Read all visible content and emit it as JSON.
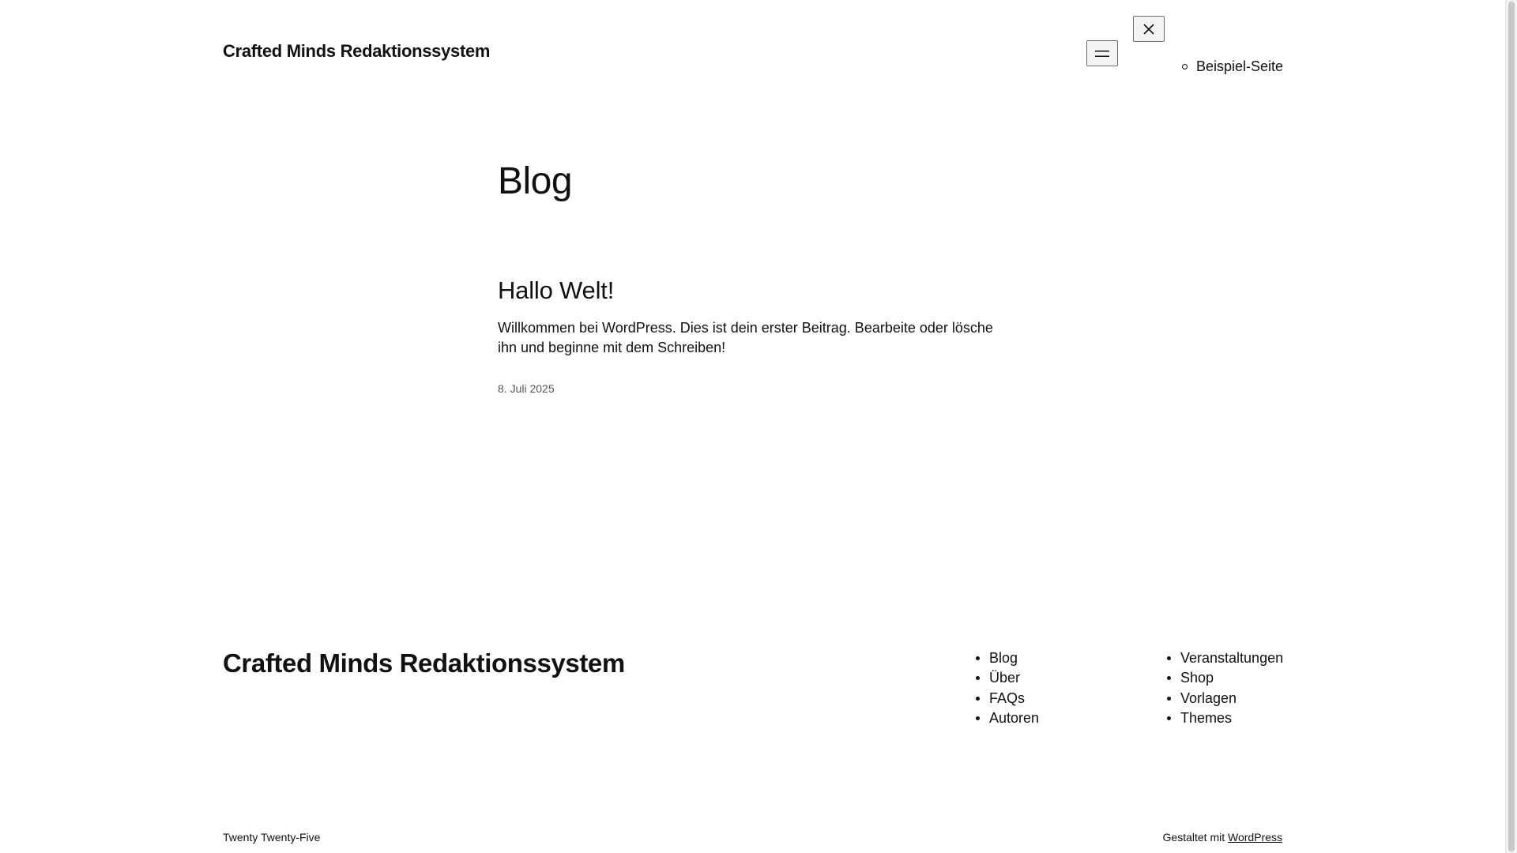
{
  "header": {
    "site_title": "Crafted Minds Redaktionssystem",
    "menu_open_icon": "menu-icon",
    "menu_close_icon": "close-icon",
    "overlay_nav": [
      {
        "label": "Beispiel-Seite"
      }
    ]
  },
  "main": {
    "page_title": "Blog",
    "posts": [
      {
        "title": "Hallo Welt!",
        "excerpt": "Willkommen bei WordPress. Dies ist dein erster Beitrag. Bearbeite oder lösche ihn und beginne mit dem Schreiben!",
        "date": "8. Juli 2025"
      }
    ]
  },
  "footer": {
    "site_title": "Crafted Minds Redaktionssystem",
    "nav_col1": [
      {
        "label": "Blog"
      },
      {
        "label": "Über"
      },
      {
        "label": "FAQs"
      },
      {
        "label": "Autoren"
      }
    ],
    "nav_col2": [
      {
        "label": "Veranstaltungen"
      },
      {
        "label": "Shop"
      },
      {
        "label": "Vorlagen"
      },
      {
        "label": "Themes"
      }
    ],
    "theme_credit": "Twenty Twenty-Five",
    "designed_with_prefix": "Gestaltet mit",
    "designed_with_link": "WordPress"
  },
  "colors": {
    "background": "#ffffff",
    "text": "#111111",
    "muted_text": "#555555"
  }
}
